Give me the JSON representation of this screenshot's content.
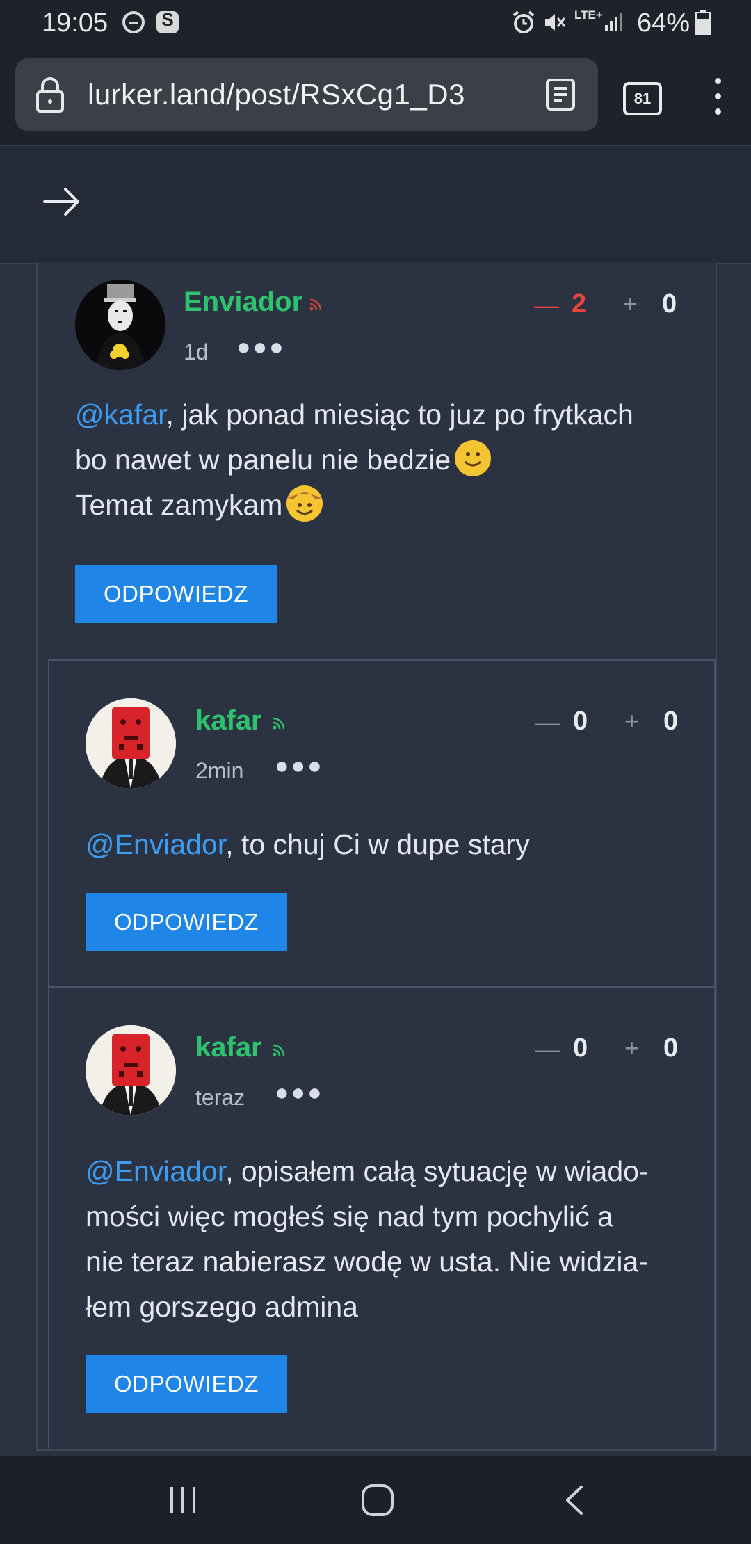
{
  "status_bar": {
    "time": "19:05",
    "network": "LTE+",
    "battery": "64%",
    "icons": [
      "do-not-disturb-icon",
      "s-app-icon",
      "alarm-icon",
      "mute-icon",
      "signal-icon",
      "battery-icon"
    ]
  },
  "browser": {
    "url": "lurker.land/post/RSxCg1_D3",
    "tab_count": "81"
  },
  "comments": [
    {
      "username": "Enviador",
      "time": "1d",
      "minus_votes": "2",
      "plus_votes": "0",
      "mention": "@kafar",
      "line1_rest": ", jak ponad miesiąc to juz po frytkach",
      "line2": "bo nawet w panelu nie bedzie",
      "line3": "Temat zamykam",
      "reply_label": "ODPOWIEDZ"
    },
    {
      "username": "kafar",
      "time": "2min",
      "minus_votes": "0",
      "plus_votes": "0",
      "mention": "@Enviador",
      "line1_rest": ", to chuj Ci w dupe stary",
      "reply_label": "ODPOWIEDZ"
    },
    {
      "username": "kafar",
      "time": "teraz",
      "minus_votes": "0",
      "plus_votes": "0",
      "mention": "@Enviador",
      "line1_rest": ", opisałem całą sytuację w wiado-",
      "line2": "mości więc mogłeś się nad tym pochylić a",
      "line3": "nie teraz nabierasz wodę w usta. Nie widzia-",
      "line4": "łem gorszego admina",
      "reply_label": "ODPOWIEDZ"
    }
  ],
  "colors": {
    "username_green": "#2ec26e",
    "mention_blue": "#3d9bf0",
    "button_blue": "#1f86e8",
    "downvote_red": "#e8443a",
    "background": "#2b3342"
  }
}
